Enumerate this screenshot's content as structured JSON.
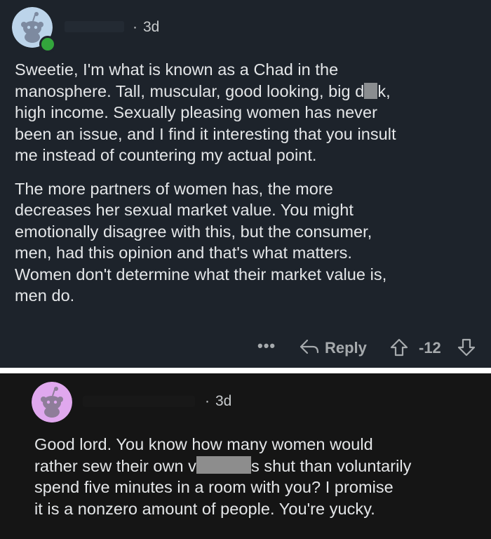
{
  "comment1": {
    "timestamp": "3d",
    "paragraphs": [
      [
        "Sweetie, I'm what is known as a Chad in the",
        [
          "manosphere.  Tall, muscular, good looking, big d",
          "k,"
        ],
        "high income.  Sexually pleasing women has never",
        "been an issue, and I find it interesting that you insult",
        "me instead of countering my actual point."
      ],
      [
        "The more partners of women has, the more",
        "decreases her sexual market value. You might",
        "emotionally disagree with this, but the consumer,",
        "men, had this opinion and that's what matters.",
        "Women don't determine what their market value is,",
        "men do."
      ]
    ],
    "actions": {
      "more": "•••",
      "reply": "Reply",
      "score": "-12"
    }
  },
  "comment2": {
    "timestamp": "3d",
    "paragraphs": [
      [
        "Good lord. You know how many women would",
        [
          "rather sew their own v",
          "s shut than voluntarily"
        ],
        "spend five minutes in a room with you? I promise",
        "it is a nonzero amount of people. You're yucky."
      ]
    ]
  },
  "colors": {
    "card1_bg": "#1d232b",
    "card2_bg": "#151515",
    "text": "#e4e6e8",
    "muted": "#a6aaad",
    "online": "#33a53c",
    "avatar1_bg": "#bcd4ea",
    "avatar2_bg": "#e0a8ee"
  },
  "icons": [
    "snoo-avatar-icon",
    "online-status-icon",
    "more-options-icon",
    "reply-arrow-icon",
    "upvote-arrow-icon",
    "downvote-arrow-icon"
  ]
}
